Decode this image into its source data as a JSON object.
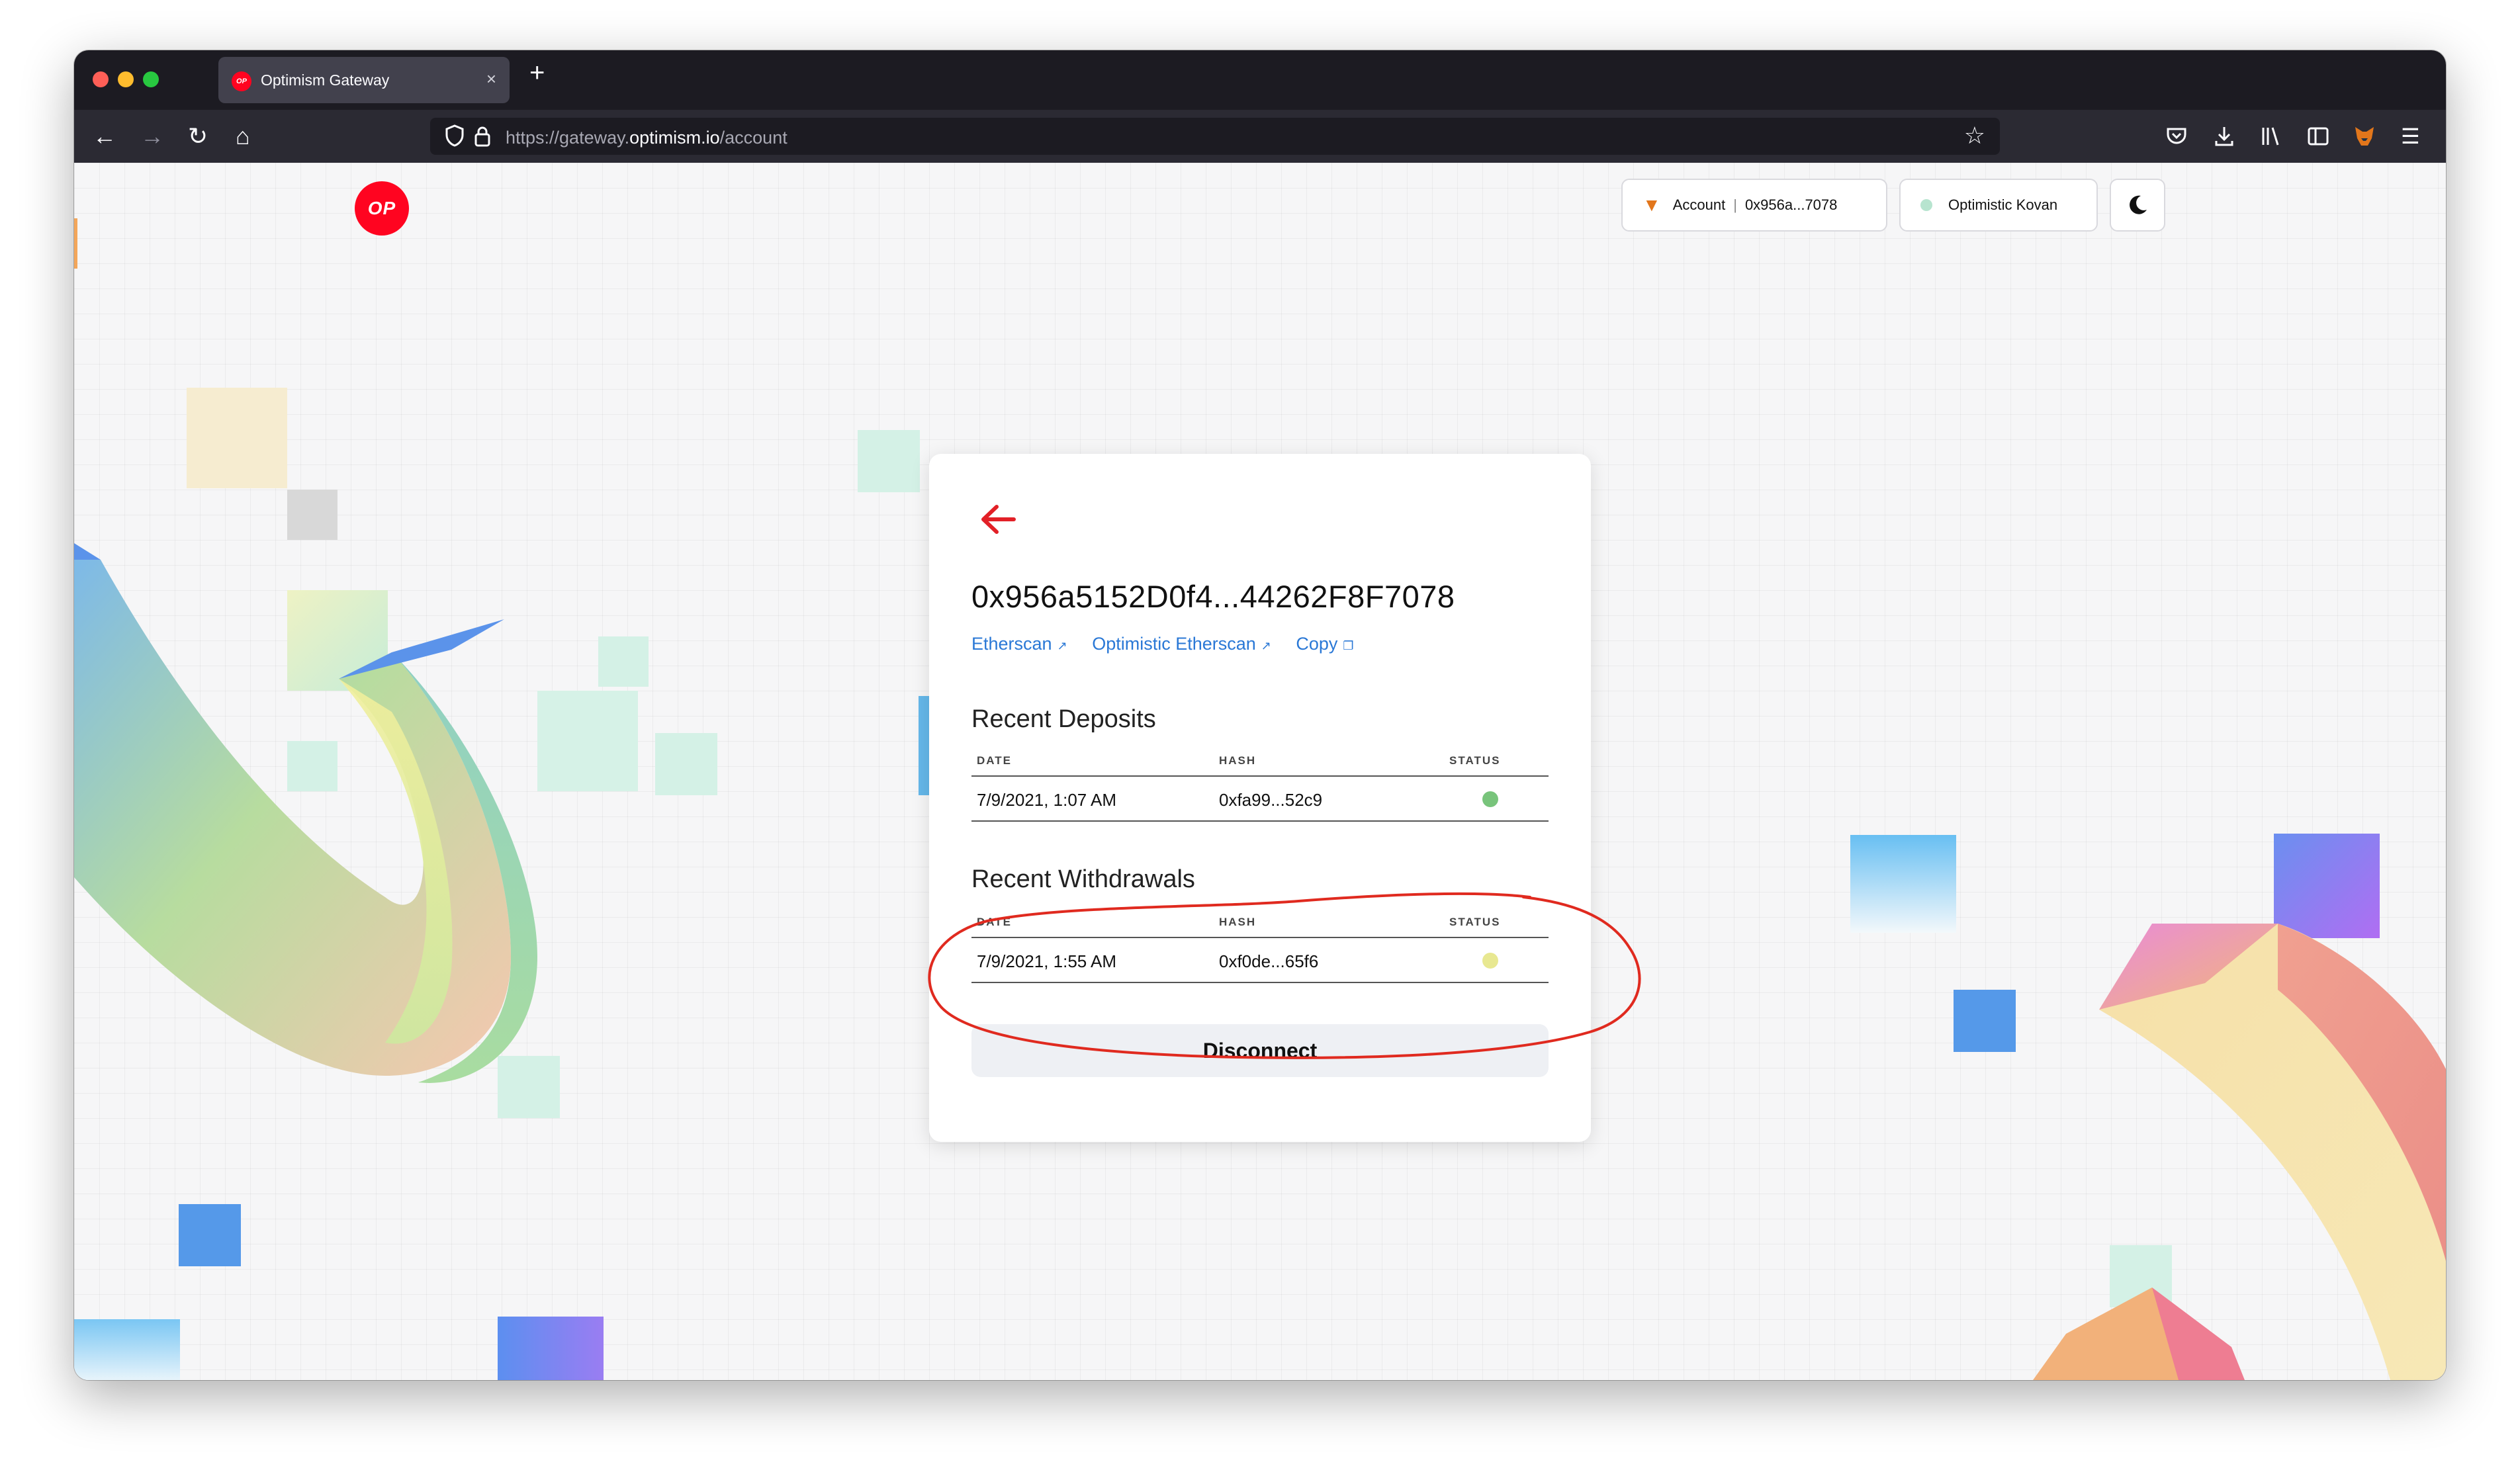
{
  "browser": {
    "tab": {
      "title": "Optimism Gateway",
      "favicon_text": "OP",
      "close_glyph": "×"
    },
    "new_tab_glyph": "+",
    "nav": {
      "back": "←",
      "forward": "→",
      "reload": "↻",
      "home": "⌂"
    },
    "url": {
      "scheme": "https://gateway.",
      "host": "optimism.io",
      "path": "/account"
    },
    "icons": [
      "tracking-shield-icon",
      "lock-icon",
      "bookmark-star-icon",
      "pocket-icon",
      "download-icon",
      "library-icon",
      "sidebar-icon",
      "metamask-extension-icon",
      "hamburger-menu-icon"
    ]
  },
  "header": {
    "logo_text": "OP",
    "account_label": "Account",
    "account_separator": "|",
    "account_address": "0x956a...7078",
    "network": "Optimistic Kovan",
    "network_dot_color": "#b7e4cf",
    "theme_toggle_icon": "moon-icon"
  },
  "card": {
    "back_icon": "arrow-left-icon",
    "address": "0x956a5152D0f4...44262F8F7078",
    "links": {
      "etherscan": "Etherscan",
      "optimistic_etherscan": "Optimistic Etherscan",
      "copy": "Copy"
    },
    "deposits": {
      "title": "Recent Deposits",
      "columns": [
        "DATE",
        "HASH",
        "STATUS"
      ],
      "rows": [
        {
          "date": "7/9/2021, 1:07 AM",
          "hash": "0xfa99...52c9",
          "status_color": "#78c47b"
        }
      ]
    },
    "withdrawals": {
      "title": "Recent Withdrawals",
      "columns": [
        "DATE",
        "HASH",
        "STATUS"
      ],
      "rows": [
        {
          "date": "7/9/2021, 1:55 AM",
          "hash": "0xf0de...65f6",
          "status_color": "#e8e891"
        }
      ]
    },
    "disconnect_label": "Disconnect"
  },
  "colors": {
    "accent_red": "#e22027",
    "link_blue": "#2a78d6",
    "annotation_red": "#e02a1f"
  }
}
